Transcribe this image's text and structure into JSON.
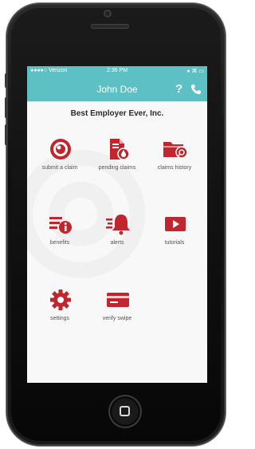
{
  "status_bar": {
    "carrier": "●●●●○ Verizon",
    "time": "2:36 PM",
    "right": "● ⌘ ▭"
  },
  "nav": {
    "title": "John Doe",
    "help": "?"
  },
  "employer": "Best Employer Ever, Inc.",
  "tiles": [
    {
      "label": "submit a claim",
      "icon": "target-icon"
    },
    {
      "label": "pending claims",
      "icon": "document-drop-icon"
    },
    {
      "label": "claims history",
      "icon": "folder-search-icon"
    },
    {
      "label": "benefits",
      "icon": "list-info-icon"
    },
    {
      "label": "alerts",
      "icon": "bell-icon"
    },
    {
      "label": "tutorials",
      "icon": "video-play-icon"
    },
    {
      "label": "settings",
      "icon": "gear-icon"
    },
    {
      "label": "verify swipe",
      "icon": "card-icon"
    }
  ],
  "colors": {
    "header": "#5cc0c4",
    "icons": "#c0262d"
  }
}
